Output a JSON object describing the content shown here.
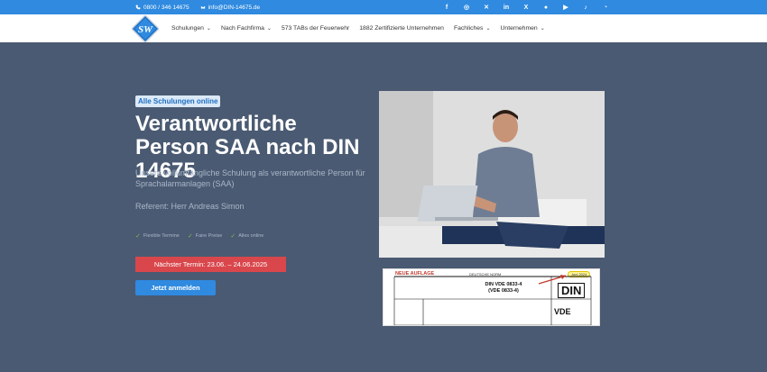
{
  "topbar": {
    "phone": "0800 / 346 14675",
    "email": "info@DIN-14675.de",
    "socials": [
      "facebook-icon",
      "instagram-icon",
      "xing-icon",
      "linkedin-icon",
      "x-icon",
      "pinterest-icon",
      "youtube-icon",
      "tiktok-icon",
      "whatsapp-icon"
    ]
  },
  "nav": {
    "items": [
      {
        "label": "Schulungen",
        "dropdown": true
      },
      {
        "label": "Nach Fachfirma",
        "dropdown": true
      },
      {
        "label": "573 TABs der Feuerwehr",
        "dropdown": false
      },
      {
        "label": "1882 Zertifizierte Unternehmen",
        "dropdown": false
      },
      {
        "label": "Fachliches",
        "dropdown": true
      },
      {
        "label": "Unternehmen",
        "dropdown": true
      }
    ]
  },
  "hero": {
    "badge": "Alle Schulungen online",
    "title": "Verantwortliche Person SAA nach DIN 14675",
    "subtitle": "Unsere vollumfängliche Schulung als verantwortliche Person für Sprachalarmanlagen (SAA)",
    "referent": "Referent: Herr Andreas Simon",
    "checks": [
      "Flexible Termine",
      "Faire Preise",
      "Alles online"
    ],
    "termin": "Nächster Termin: 23.06. – 24.06.2025",
    "cta": "Jetzt anmelden"
  },
  "document": {
    "new_label": "NEUE AUFLAGE",
    "norm_label": "DEUTSCHE NORM",
    "date_label": "Juni 2024",
    "din_line1": "DIN VDE 0833-4",
    "din_line2": "(VDE 0833-4)",
    "din_logo": "DIN",
    "vde_logo": "VDE"
  },
  "colors": {
    "background": "#4a5a72",
    "topbar": "#2f8ae0",
    "termin": "#d9474c",
    "cta": "#2f8ae0",
    "badge_bg": "#dbe9f7",
    "check": "#7dbb4d"
  }
}
